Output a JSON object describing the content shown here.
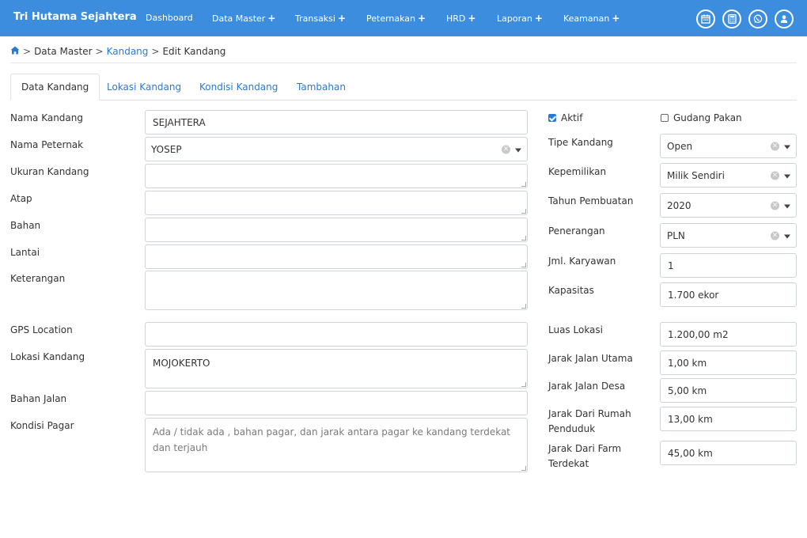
{
  "navbar": {
    "brand": "Tri Hutama Sejahtera",
    "items": [
      {
        "label": "Dashboard",
        "plus": ""
      },
      {
        "label": "Data Master",
        "plus": "+"
      },
      {
        "label": "Transaksi",
        "plus": "+"
      },
      {
        "label": "Peternakan",
        "plus": "+"
      },
      {
        "label": "HRD",
        "plus": "+"
      },
      {
        "label": "Laporan",
        "plus": "+"
      },
      {
        "label": "Keamanan",
        "plus": "+"
      }
    ],
    "icons": [
      "calendar-icon",
      "calculator-icon",
      "whatsapp-icon",
      "user-icon"
    ]
  },
  "breadcrumb": {
    "home_icon": "home-icon",
    "sep": ">",
    "data_master": "Data Master",
    "kandang": "Kandang",
    "current": "Edit Kandang"
  },
  "tabs": [
    {
      "label": "Data Kandang",
      "active": true
    },
    {
      "label": "Lokasi Kandang",
      "active": false
    },
    {
      "label": "Kondisi Kandang",
      "active": false
    },
    {
      "label": "Tambahan",
      "active": false
    }
  ],
  "left_form": {
    "nama_kandang": {
      "label": "Nama Kandang",
      "value": "SEJAHTERA"
    },
    "nama_peternak": {
      "label": "Nama Peternak",
      "value": "YOSEP"
    },
    "ukuran_kandang": {
      "label": "Ukuran Kandang",
      "value": ""
    },
    "atap": {
      "label": "Atap",
      "value": ""
    },
    "bahan": {
      "label": "Bahan",
      "value": ""
    },
    "lantai": {
      "label": "Lantai",
      "value": ""
    },
    "keterangan": {
      "label": "Keterangan",
      "value": ""
    },
    "gps_location": {
      "label": "GPS Location",
      "value": ""
    },
    "lokasi_kandang": {
      "label": "Lokasi Kandang",
      "value": "MOJOKERTO"
    },
    "bahan_jalan": {
      "label": "Bahan Jalan",
      "value": ""
    },
    "kondisi_pagar": {
      "label": "Kondisi Pagar",
      "value": "",
      "placeholder": "Ada / tidak ada , bahan pagar, dan jarak antara pagar ke kandang terdekat dan terjauh"
    }
  },
  "right_form": {
    "aktif": {
      "label": "Aktif",
      "checked": true
    },
    "gudang_pakan": {
      "label": "Gudang Pakan",
      "checked": false
    },
    "tipe_kandang": {
      "label": "Tipe Kandang",
      "value": "Open"
    },
    "kepemilikan": {
      "label": "Kepemilikan",
      "value": "Milik Sendiri"
    },
    "tahun_pembuatan": {
      "label": "Tahun Pembuatan",
      "value": "2020"
    },
    "penerangan": {
      "label": "Penerangan",
      "value": "PLN"
    },
    "jml_karyawan": {
      "label": "Jml. Karyawan",
      "value": "1"
    },
    "kapasitas": {
      "label": "Kapasitas",
      "value": "1.700 ekor"
    },
    "luas_lokasi": {
      "label": "Luas Lokasi",
      "value": "1.200,00 m2"
    },
    "jarak_jalan_utama": {
      "label": "Jarak Jalan Utama",
      "value": "1,00 km"
    },
    "jarak_jalan_desa": {
      "label": "Jarak Jalan Desa",
      "value": "5,00 km"
    },
    "jarak_dari_rumah_penduduk": {
      "label_line1": "Jarak Dari Rumah",
      "label_line2": "Penduduk",
      "value": "13,00 km"
    },
    "jarak_dari_farm_terdekat": {
      "label_line1": "Jarak Dari Farm",
      "label_line2": "Terdekat",
      "value": "45,00 km"
    }
  },
  "colors": {
    "navbar": "#3c8ddd",
    "link": "#2a7ad3"
  }
}
